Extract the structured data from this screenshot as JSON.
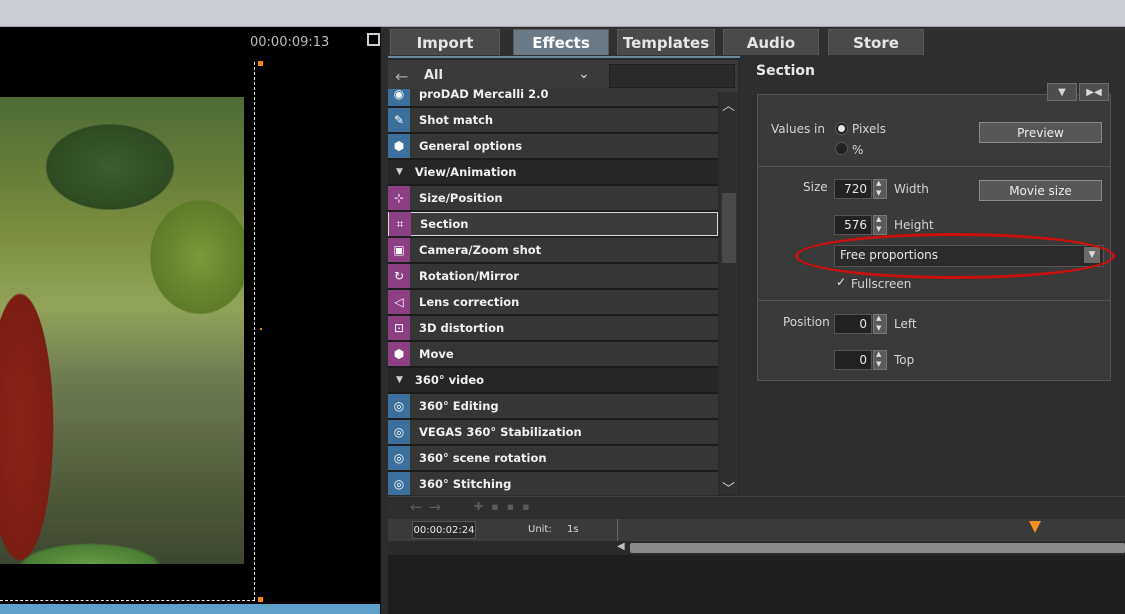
{
  "preview": {
    "timecode": "00:00:09:13"
  },
  "tabs": [
    "Import",
    "Effects",
    "Templates",
    "Audio",
    "Store"
  ],
  "active_tab": "Effects",
  "effects_panel": {
    "filter_label": "All",
    "items": [
      {
        "type": "effect",
        "label": "proDAD Mercalli 2.0",
        "icon": "mercalli-icon",
        "color": "blue"
      },
      {
        "type": "effect",
        "label": "Shot match",
        "icon": "shot-match-icon",
        "color": "blue"
      },
      {
        "type": "effect",
        "label": "General options",
        "icon": "hexagon-icon",
        "color": "blue"
      },
      {
        "type": "category",
        "label": "View/Animation"
      },
      {
        "type": "effect",
        "label": "Size/Position",
        "icon": "size-position-icon",
        "color": "purple"
      },
      {
        "type": "effect",
        "label": "Section",
        "icon": "crop-icon",
        "color": "purple",
        "selected": true
      },
      {
        "type": "effect",
        "label": "Camera/Zoom shot",
        "icon": "camera-icon",
        "color": "purple"
      },
      {
        "type": "effect",
        "label": "Rotation/Mirror",
        "icon": "rotation-icon",
        "color": "purple"
      },
      {
        "type": "effect",
        "label": "Lens correction",
        "icon": "lens-icon",
        "color": "purple"
      },
      {
        "type": "effect",
        "label": "3D distortion",
        "icon": "distortion-icon",
        "color": "purple"
      },
      {
        "type": "effect",
        "label": "Move",
        "icon": "hexagon-icon",
        "color": "purple"
      },
      {
        "type": "category",
        "label": "360° video"
      },
      {
        "type": "effect",
        "label": "360° Editing",
        "icon": "360-icon",
        "color": "blue"
      },
      {
        "type": "effect",
        "label": "VEGAS 360° Stabilization",
        "icon": "360-icon",
        "color": "blue"
      },
      {
        "type": "effect",
        "label": "360° scene rotation",
        "icon": "360-icon",
        "color": "blue"
      },
      {
        "type": "effect",
        "label": "360° Stitching",
        "icon": "360-icon",
        "color": "blue"
      }
    ]
  },
  "section_panel": {
    "title": "Section",
    "values_in_label": "Values in",
    "unit_pixels": "Pixels",
    "unit_percent": "%",
    "preview_button": "Preview",
    "size_label": "Size",
    "width_value": "720",
    "width_label": "Width",
    "movie_size_button": "Movie size",
    "height_value": "576",
    "height_label": "Height",
    "proportions_value": "Free proportions",
    "fullscreen_label": "Fullscreen",
    "position_label": "Position",
    "left_value": "0",
    "left_label": "Left",
    "top_value": "0",
    "top_label": "Top"
  },
  "timeline": {
    "time": "00:00:02:24",
    "unit_label": "Unit:",
    "unit_value": "1s"
  },
  "colors": {
    "highlight_oval": "#cc1010",
    "marker": "#f09020",
    "tab_active": "#6c7a86"
  }
}
